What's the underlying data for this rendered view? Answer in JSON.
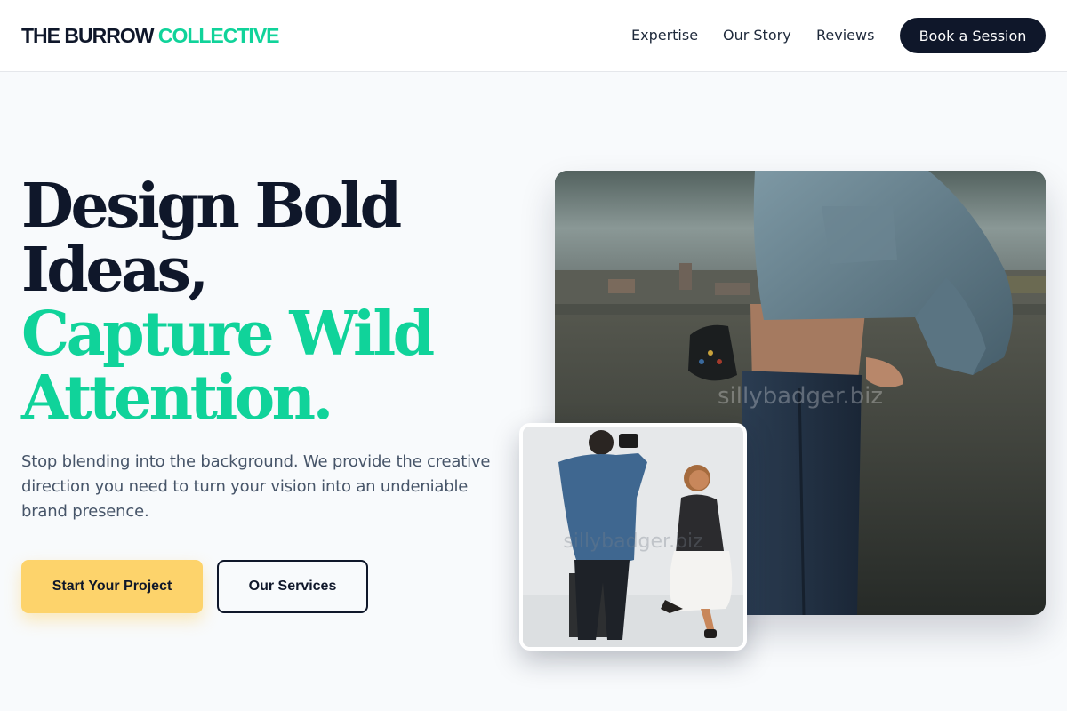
{
  "header": {
    "brand_dark": "THE BURROW",
    "brand_accent": "COLLECTIVE",
    "nav": [
      {
        "label": "Expertise"
      },
      {
        "label": "Our Story"
      },
      {
        "label": "Reviews"
      }
    ],
    "cta_label": "Book a Session"
  },
  "hero": {
    "headline_dark": [
      "Design Bold",
      "Ideas,"
    ],
    "headline_accent": [
      "Capture Wild",
      "Attention."
    ],
    "subtext": "Stop blending into the background. We provide the creative direction you need to turn your vision into an undeniable brand presence.",
    "primary_button": "Start Your Project",
    "secondary_button": "Our Services"
  },
  "images": {
    "main_watermark": "sillybadger.biz",
    "inset_watermark": "sillybadger.biz"
  },
  "colors": {
    "accent": "#10d39a",
    "navy": "#0f172a",
    "yellow": "#fdd36b",
    "background": "#f8fafc"
  }
}
